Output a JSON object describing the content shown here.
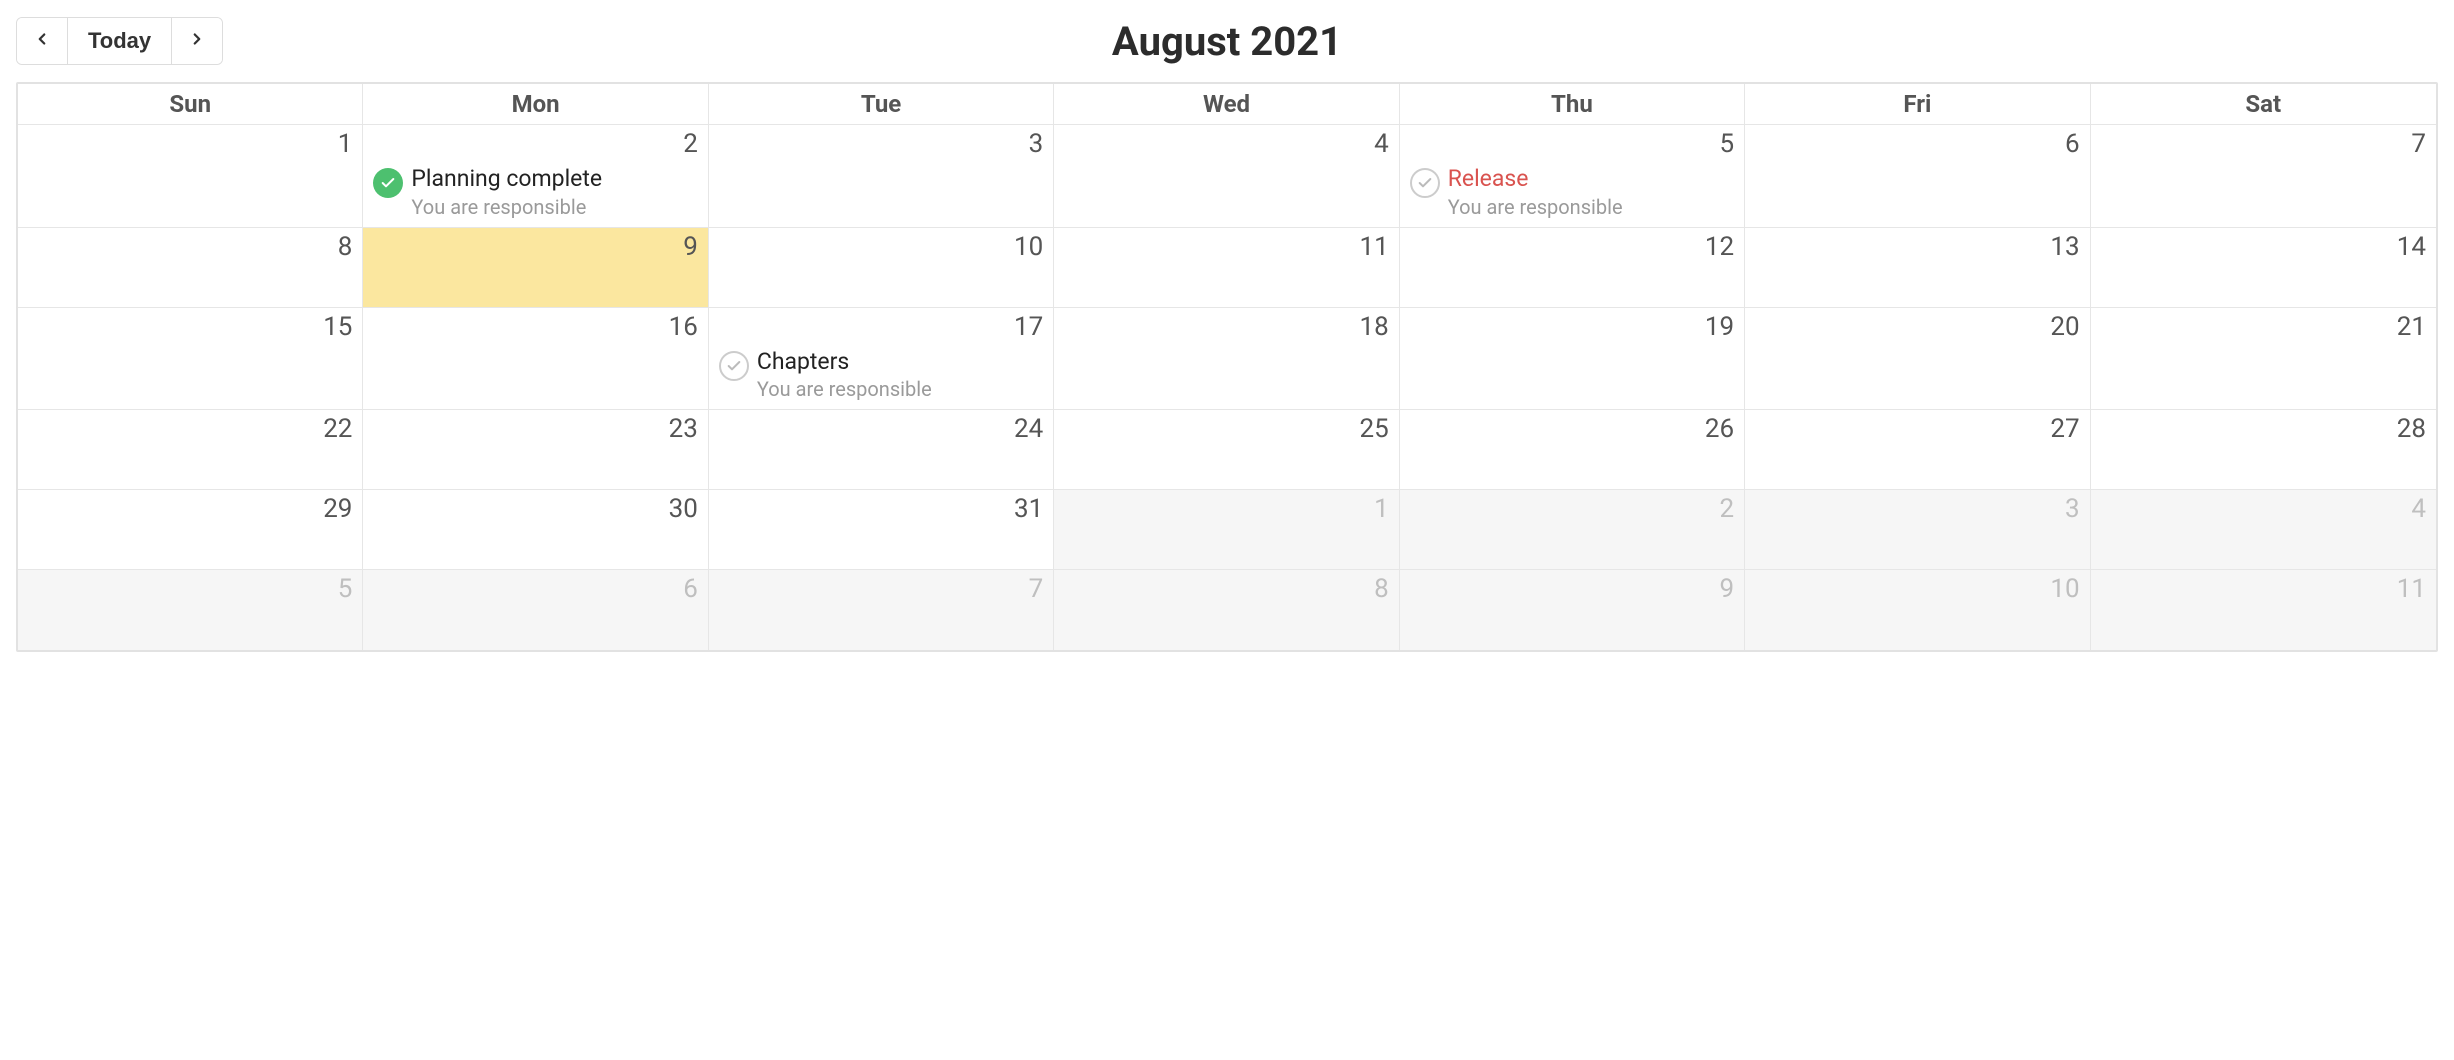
{
  "header": {
    "title": "August 2021",
    "today_label": "Today"
  },
  "weekdays": [
    "Sun",
    "Mon",
    "Tue",
    "Wed",
    "Thu",
    "Fri",
    "Sat"
  ],
  "weeks": [
    [
      {
        "num": "1",
        "other": false,
        "today": false,
        "events": []
      },
      {
        "num": "2",
        "other": false,
        "today": false,
        "events": [
          {
            "title": "Planning complete",
            "sub": "You are responsible",
            "status": "done",
            "alert": false
          }
        ]
      },
      {
        "num": "3",
        "other": false,
        "today": false,
        "events": []
      },
      {
        "num": "4",
        "other": false,
        "today": false,
        "events": []
      },
      {
        "num": "5",
        "other": false,
        "today": false,
        "events": [
          {
            "title": "Release",
            "sub": "You are responsible",
            "status": "open",
            "alert": true
          }
        ]
      },
      {
        "num": "6",
        "other": false,
        "today": false,
        "events": []
      },
      {
        "num": "7",
        "other": false,
        "today": false,
        "events": []
      }
    ],
    [
      {
        "num": "8",
        "other": false,
        "today": false,
        "events": []
      },
      {
        "num": "9",
        "other": false,
        "today": true,
        "events": []
      },
      {
        "num": "10",
        "other": false,
        "today": false,
        "events": []
      },
      {
        "num": "11",
        "other": false,
        "today": false,
        "events": []
      },
      {
        "num": "12",
        "other": false,
        "today": false,
        "events": []
      },
      {
        "num": "13",
        "other": false,
        "today": false,
        "events": []
      },
      {
        "num": "14",
        "other": false,
        "today": false,
        "events": []
      }
    ],
    [
      {
        "num": "15",
        "other": false,
        "today": false,
        "events": []
      },
      {
        "num": "16",
        "other": false,
        "today": false,
        "events": []
      },
      {
        "num": "17",
        "other": false,
        "today": false,
        "events": [
          {
            "title": "Chapters",
            "sub": "You are responsible",
            "status": "open",
            "alert": false
          }
        ]
      },
      {
        "num": "18",
        "other": false,
        "today": false,
        "events": []
      },
      {
        "num": "19",
        "other": false,
        "today": false,
        "events": []
      },
      {
        "num": "20",
        "other": false,
        "today": false,
        "events": []
      },
      {
        "num": "21",
        "other": false,
        "today": false,
        "events": []
      }
    ],
    [
      {
        "num": "22",
        "other": false,
        "today": false,
        "events": []
      },
      {
        "num": "23",
        "other": false,
        "today": false,
        "events": []
      },
      {
        "num": "24",
        "other": false,
        "today": false,
        "events": []
      },
      {
        "num": "25",
        "other": false,
        "today": false,
        "events": []
      },
      {
        "num": "26",
        "other": false,
        "today": false,
        "events": []
      },
      {
        "num": "27",
        "other": false,
        "today": false,
        "events": []
      },
      {
        "num": "28",
        "other": false,
        "today": false,
        "events": []
      }
    ],
    [
      {
        "num": "29",
        "other": false,
        "today": false,
        "events": []
      },
      {
        "num": "30",
        "other": false,
        "today": false,
        "events": []
      },
      {
        "num": "31",
        "other": false,
        "today": false,
        "events": []
      },
      {
        "num": "1",
        "other": true,
        "today": false,
        "events": []
      },
      {
        "num": "2",
        "other": true,
        "today": false,
        "events": []
      },
      {
        "num": "3",
        "other": true,
        "today": false,
        "events": []
      },
      {
        "num": "4",
        "other": true,
        "today": false,
        "events": []
      }
    ],
    [
      {
        "num": "5",
        "other": true,
        "today": false,
        "events": []
      },
      {
        "num": "6",
        "other": true,
        "today": false,
        "events": []
      },
      {
        "num": "7",
        "other": true,
        "today": false,
        "events": []
      },
      {
        "num": "8",
        "other": true,
        "today": false,
        "events": []
      },
      {
        "num": "9",
        "other": true,
        "today": false,
        "events": []
      },
      {
        "num": "10",
        "other": true,
        "today": false,
        "events": []
      },
      {
        "num": "11",
        "other": true,
        "today": false,
        "events": []
      }
    ]
  ]
}
